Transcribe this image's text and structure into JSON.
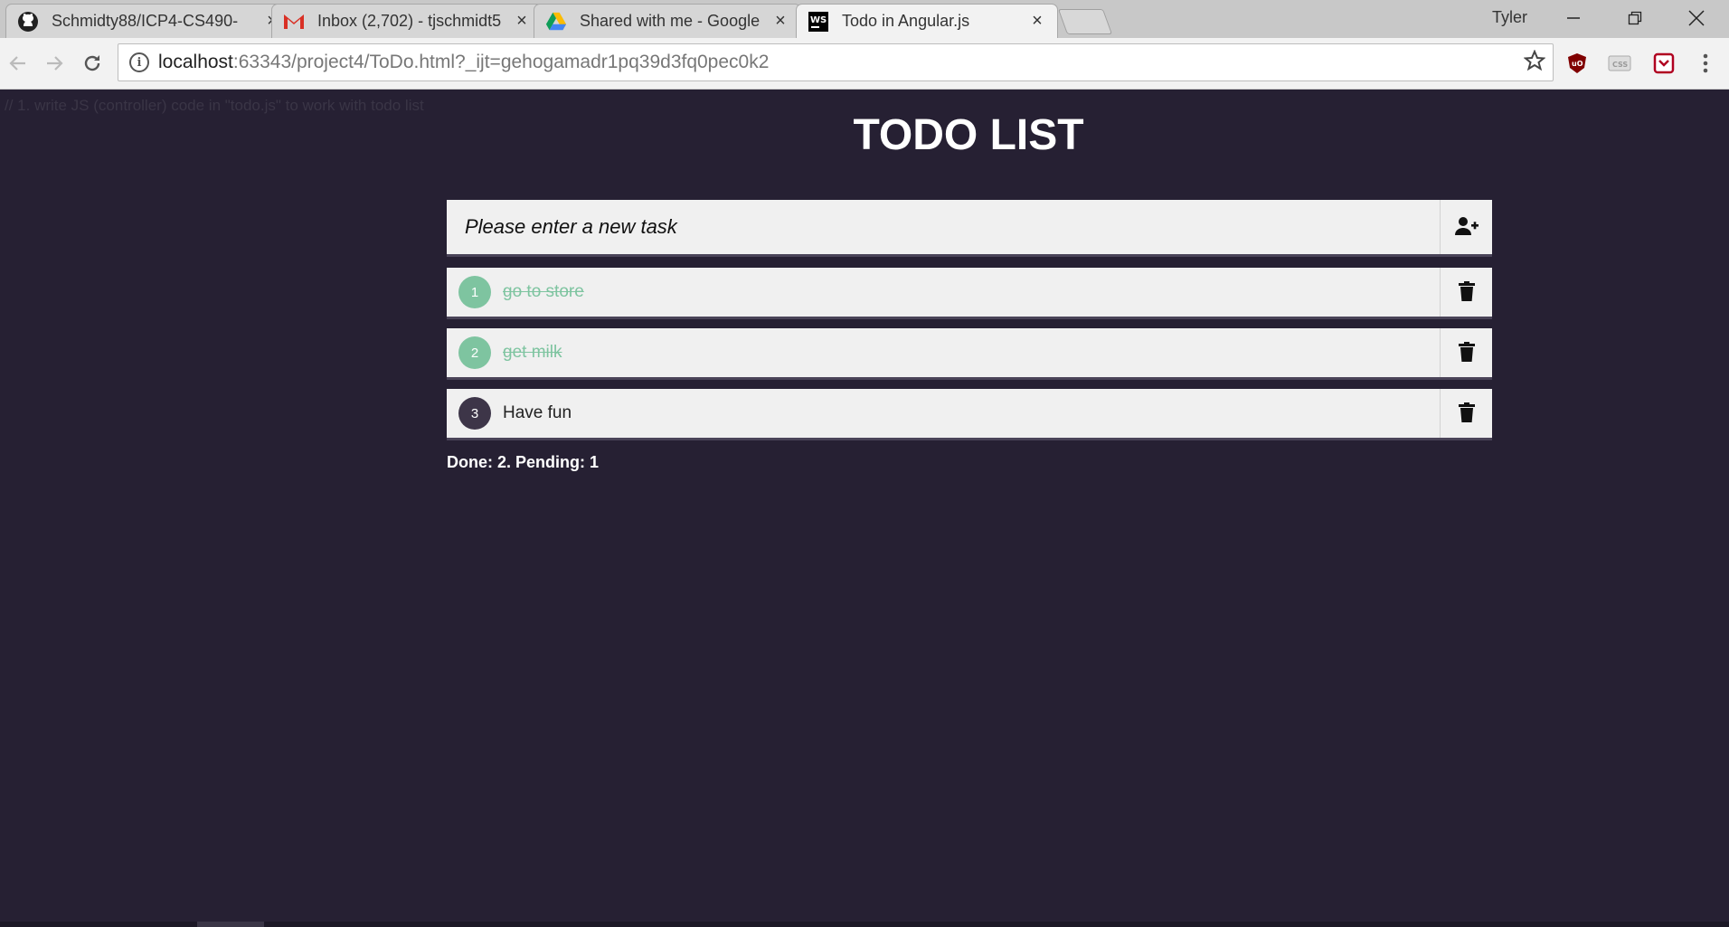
{
  "browser": {
    "tabs": [
      {
        "title": "Schmidty88/ICP4-CS490-",
        "favicon": "github-icon",
        "active": false
      },
      {
        "title": "Inbox (2,702) - tjschmidt5",
        "favicon": "gmail-icon",
        "active": false
      },
      {
        "title": "Shared with me - Google",
        "favicon": "google-drive-icon",
        "active": false
      },
      {
        "title": "Todo in Angular.js",
        "favicon": "webstorm-icon",
        "active": true
      }
    ],
    "close_glyph": "×",
    "profile_name": "Tyler",
    "url_host": "localhost",
    "url_path": ":63343/project4/ToDo.html?_ijt=gehogamadr1pq39d3fq0pec0k2"
  },
  "page": {
    "comment": "// 1. write JS (controller) code in \"todo.js\" to work with todo list",
    "title": "TODO LIST",
    "input_placeholder": "Please enter a new task",
    "input_value": "",
    "todos": [
      {
        "number": "1",
        "text": "go to store",
        "done": true
      },
      {
        "number": "2",
        "text": "get milk",
        "done": true
      },
      {
        "number": "3",
        "text": "Have fun",
        "done": false
      }
    ],
    "status": "Done: 2. Pending: 1"
  },
  "colors": {
    "page_background": "#262033",
    "done_accent": "#7ec4a0",
    "pending_circle": "#3d3548",
    "item_background": "#f0f0f0"
  }
}
